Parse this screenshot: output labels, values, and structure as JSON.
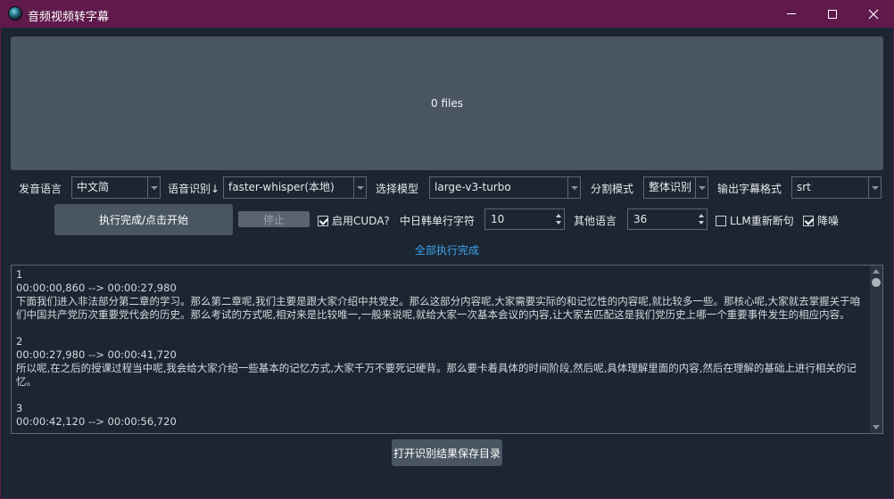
{
  "window": {
    "title": "音频视频转字幕",
    "controls": [
      "minimize-icon",
      "maximize-icon",
      "close-icon"
    ],
    "accent_color": "#5f1a4b",
    "background_color": "#1b2632"
  },
  "dropzone": {
    "text": "0 files"
  },
  "settings": {
    "language_label": "发音语言",
    "language_value": "中文简",
    "asr_label": "语音识别↓",
    "asr_value": "faster-whisper(本地)",
    "model_label": "选择模型",
    "model_value": "large-v3-turbo",
    "split_label": "分割模式",
    "split_value": "整体识别",
    "format_label": "输出字幕格式",
    "format_value": "srt"
  },
  "actions": {
    "start_label": "执行完成/点击开始",
    "stop_label": "停止",
    "cuda_label": "启用CUDA?",
    "cuda_checked": true,
    "cjk_chars_label": "中日韩单行字符",
    "cjk_chars_value": "10",
    "other_lang_label": "其他语言",
    "other_lang_value": "36",
    "llm_label": "LLM重新断句",
    "llm_checked": false,
    "denoise_label": "降噪",
    "denoise_checked": true
  },
  "status": {
    "text": "全部执行完成",
    "color": "#3fa3e8"
  },
  "log": {
    "entries": [
      {
        "index": "1",
        "time": "00:00:00,860 --> 00:00:27,980",
        "text": "下面我们进入非法部分第二章的学习。那么第二章呢,我们主要是跟大家介绍中共党史。那么这部分内容呢,大家需要实际的和记忆性的内容呢,就比较多一些。那核心呢,大家就去掌握关于咱们中国共产党历次重要党代会的历史。那么考试的方式呢,相对来是比较唯一,一般来说呢,就给大家一次基本会议的内容,让大家去匹配这是我们党历史上哪一个重要事件发生的相应内容。"
      },
      {
        "index": "2",
        "time": "00:00:27,980 --> 00:00:41,720",
        "text": "所以呢,在之后的授课过程当中呢,我会给大家介绍一些基本的记忆方式,大家千万不要死记硬背。那么要卡着具体的时间阶段,然后呢,具体理解里面的内容,然后在理解的基础上进行相关的记忆。"
      },
      {
        "index": "3",
        "time": "00:00:42,120 --> 00:00:56,720",
        "text": ""
      }
    ]
  },
  "footer": {
    "open_dir_label": "打开识别结果保存目录"
  }
}
